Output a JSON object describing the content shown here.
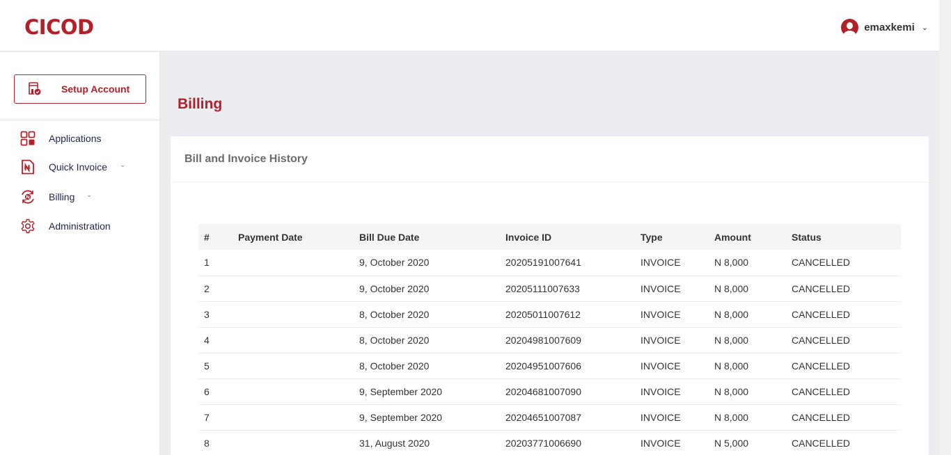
{
  "header": {
    "logo": "CICOD",
    "username": "emaxkemi"
  },
  "sidebar": {
    "setup_label": "Setup Account",
    "items": [
      {
        "label": "Applications",
        "icon": "applications-grid-icon",
        "expandable": false
      },
      {
        "label": "Quick Invoice",
        "icon": "invoice-naira-icon",
        "expandable": true
      },
      {
        "label": "Billing",
        "icon": "billing-cycle-icon",
        "expandable": true
      },
      {
        "label": "Administration",
        "icon": "gear-icon",
        "expandable": false
      }
    ]
  },
  "main": {
    "page_title": "Billing",
    "card_title": "Bill and Invoice History",
    "columns": [
      "#",
      "Payment Date",
      "Bill Due Date",
      "Invoice ID",
      "Type",
      "Amount",
      "Status"
    ],
    "rows": [
      {
        "num": "1",
        "payment_date": "",
        "due_date": "9, October 2020",
        "invoice_id": "20205191007641",
        "type": "INVOICE",
        "amount": "N 8,000",
        "status": "CANCELLED"
      },
      {
        "num": "2",
        "payment_date": "",
        "due_date": "9, October 2020",
        "invoice_id": "20205111007633",
        "type": "INVOICE",
        "amount": "N 8,000",
        "status": "CANCELLED"
      },
      {
        "num": "3",
        "payment_date": "",
        "due_date": "8, October 2020",
        "invoice_id": "20205011007612",
        "type": "INVOICE",
        "amount": "N 8,000",
        "status": "CANCELLED"
      },
      {
        "num": "4",
        "payment_date": "",
        "due_date": "8, October 2020",
        "invoice_id": "20204981007609",
        "type": "INVOICE",
        "amount": "N 8,000",
        "status": "CANCELLED"
      },
      {
        "num": "5",
        "payment_date": "",
        "due_date": "8, October 2020",
        "invoice_id": "20204951007606",
        "type": "INVOICE",
        "amount": "N 8,000",
        "status": "CANCELLED"
      },
      {
        "num": "6",
        "payment_date": "",
        "due_date": "9, September 2020",
        "invoice_id": "20204681007090",
        "type": "INVOICE",
        "amount": "N 8,000",
        "status": "CANCELLED"
      },
      {
        "num": "7",
        "payment_date": "",
        "due_date": "9, September 2020",
        "invoice_id": "20204651007087",
        "type": "INVOICE",
        "amount": "N 8,000",
        "status": "CANCELLED"
      },
      {
        "num": "8",
        "payment_date": "",
        "due_date": "31, August 2020",
        "invoice_id": "20203771006690",
        "type": "INVOICE",
        "amount": "N 5,000",
        "status": "CANCELLED"
      }
    ]
  },
  "colors": {
    "brand": "#b3202a",
    "nav_text": "#1f2550",
    "page_bg": "#ecedf1"
  }
}
